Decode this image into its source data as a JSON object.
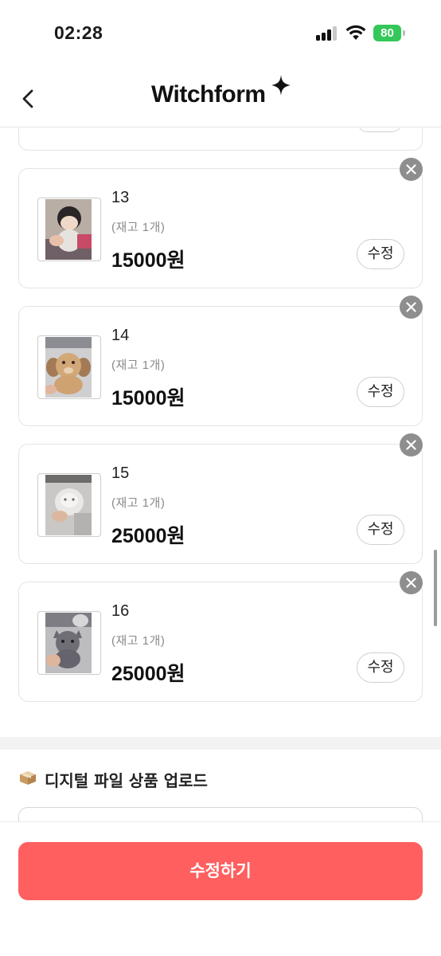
{
  "status_bar": {
    "time": "02:28",
    "battery": "80"
  },
  "header": {
    "logo_text": "Witchform",
    "back_icon": "chevron-left-icon"
  },
  "products": [
    {
      "name": "13",
      "stock": "(재고 1개)",
      "price": "15000원",
      "edit_label": "수정"
    },
    {
      "name": "14",
      "stock": "(재고 1개)",
      "price": "15000원",
      "edit_label": "수정"
    },
    {
      "name": "15",
      "stock": "(재고 1개)",
      "price": "25000원",
      "edit_label": "수정"
    },
    {
      "name": "16",
      "stock": "(재고 1개)",
      "price": "25000원",
      "edit_label": "수정"
    }
  ],
  "digital_section": {
    "icon": "box-icon",
    "title": "디지털 파일 상품 업로드"
  },
  "footer": {
    "submit_label": "수정하기"
  },
  "colors": {
    "accent": "#ff5f5f",
    "battery": "#34c759",
    "remove": "#8e8e8e"
  }
}
